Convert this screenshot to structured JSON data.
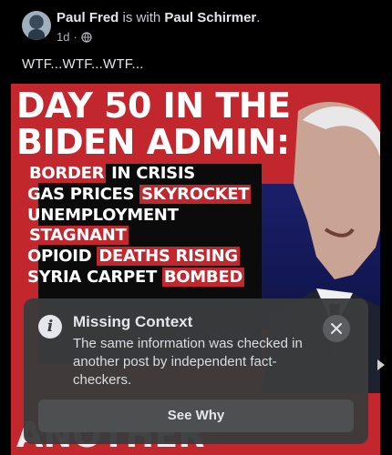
{
  "post": {
    "author": "Paul Fred",
    "with_text": "is with",
    "tagged": "Paul Schirmer",
    "period": ".",
    "time": "1d",
    "separator": "·",
    "text": "WTF...WTF...WTF...",
    "privacy_icon": "globe-icon"
  },
  "image": {
    "headline_line1": "DAY 50 IN THE",
    "headline_line2": "BIDEN ADMIN:",
    "bullet_mark": "✕",
    "bullets": [
      {
        "a": "BORDER",
        "b": " IN CRISIS"
      },
      {
        "a": "GAS PRICES ",
        "b": "SKYROCKET"
      },
      {
        "a": "UNEMPLOYMENT",
        "b": "STAGNANT"
      },
      {
        "a": "OPIOID ",
        "b": "DEATHS RISING"
      },
      {
        "a": "SYRIA CARPET ",
        "b": "BOMBED"
      }
    ],
    "bottom_partial": "ANOTHER"
  },
  "overlay": {
    "title": "Missing Context",
    "body": "The same information was checked in another post by independent fact-checkers.",
    "button": "See Why",
    "info_icon_glyph": "i"
  },
  "colors": {
    "brand_red": "#c1272d",
    "overlay_bg": "#3a3b3c"
  }
}
